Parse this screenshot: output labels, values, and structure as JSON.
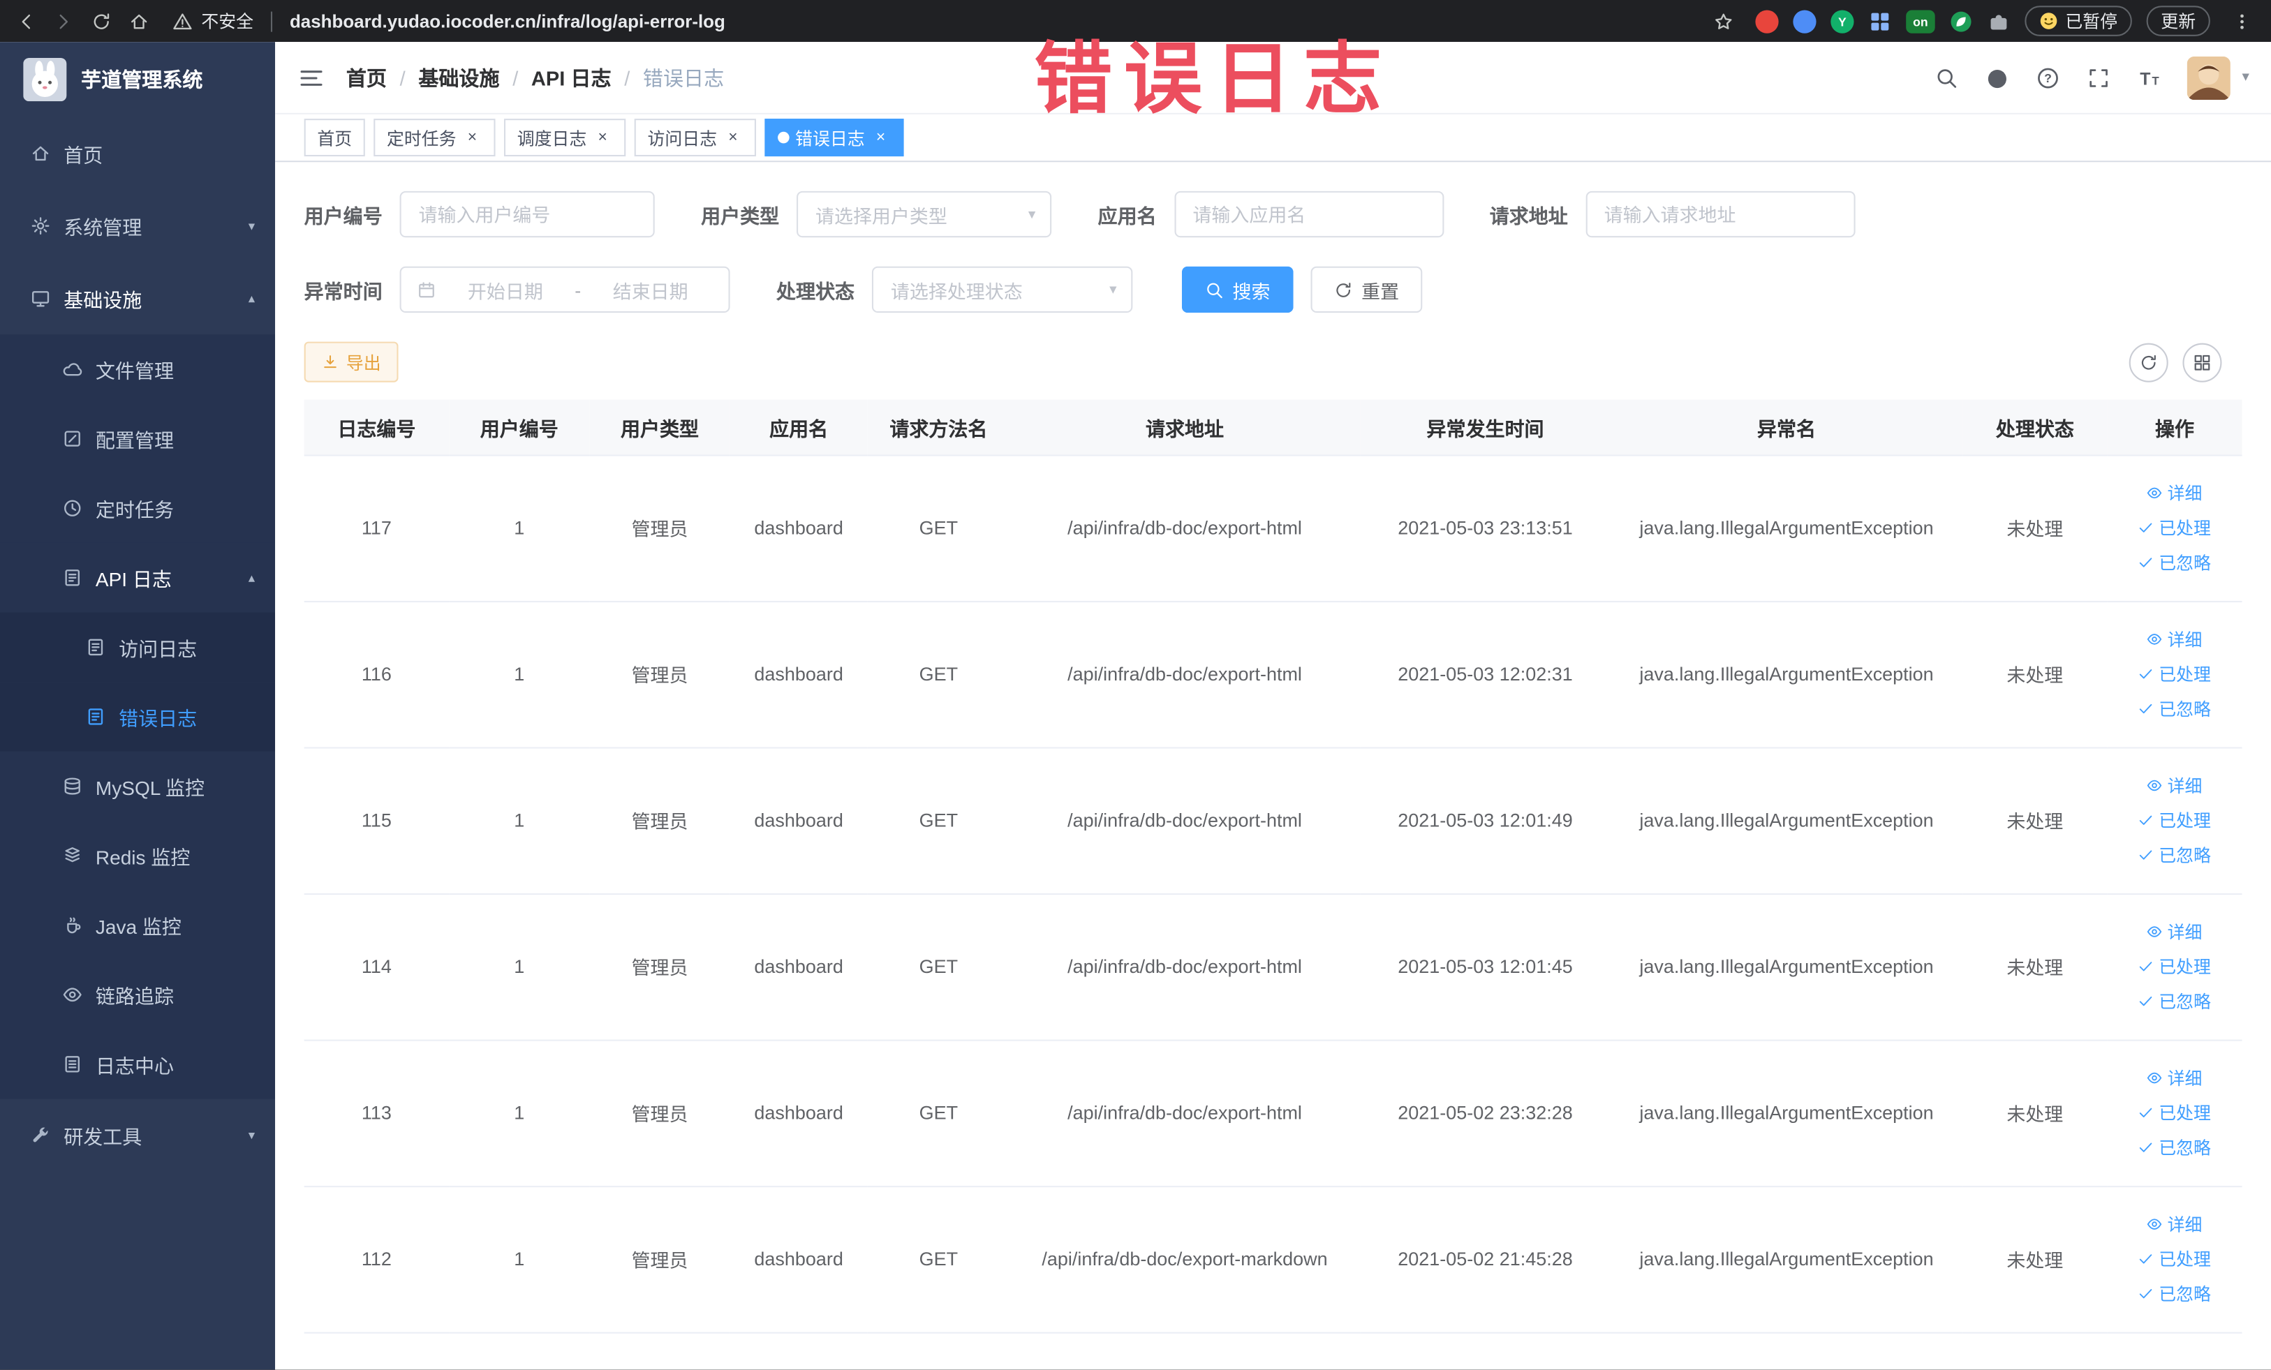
{
  "annotation": {
    "text": "错误日志",
    "color": "#ec4e5e"
  },
  "browser": {
    "security_label": "不安全",
    "url": "dashboard.yudao.iocoder.cn/infra/log/api-error-log",
    "paused_badge": "已暂停",
    "update_label": "更新",
    "extensions": [
      {
        "name": "extension-red-circle-icon",
        "style": "circle",
        "color": "#e8453c",
        "badge": ""
      },
      {
        "name": "extension-blue-drop-icon",
        "style": "circle",
        "color": "#4e8df6",
        "badge": ""
      },
      {
        "name": "extension-green-y-icon",
        "style": "circle",
        "color": "#12b06a",
        "badge": "Y"
      },
      {
        "name": "extension-grid-icon",
        "style": "grid",
        "color": "#8ab4f8",
        "badge": ""
      },
      {
        "name": "extension-on-badge-icon",
        "style": "rounded",
        "color": "#1a7f37",
        "badge": "on"
      },
      {
        "name": "extension-leaf-icon",
        "style": "leaf",
        "color": "#1e9e57",
        "badge": ""
      },
      {
        "name": "extension-puzzle-icon",
        "style": "puzzle",
        "color": "#a8adb3",
        "badge": ""
      }
    ]
  },
  "sidebar": {
    "logo_title": "芋道管理系统",
    "menu": [
      {
        "id": "home",
        "label": "首页",
        "icon": "home-icon",
        "level": 1
      },
      {
        "id": "system",
        "label": "系统管理",
        "icon": "gear-icon",
        "level": 1,
        "arrow": "down"
      },
      {
        "id": "infra",
        "label": "基础设施",
        "icon": "monitor-icon",
        "level": 1,
        "arrow": "up",
        "expanded": true
      },
      {
        "id": "file",
        "label": "文件管理",
        "icon": "cloud-icon",
        "level": 2
      },
      {
        "id": "config",
        "label": "配置管理",
        "icon": "edit-icon",
        "level": 2
      },
      {
        "id": "job",
        "label": "定时任务",
        "icon": "clock-icon",
        "level": 2
      },
      {
        "id": "api-log",
        "label": "API 日志",
        "icon": "doc-edit-icon",
        "level": 2,
        "arrow": "up",
        "expanded": true
      },
      {
        "id": "access-log",
        "label": "访问日志",
        "icon": "doc-edit-icon",
        "level": 3
      },
      {
        "id": "error-log",
        "label": "错误日志",
        "icon": "doc-edit-icon",
        "level": 3,
        "active": true
      },
      {
        "id": "mysql",
        "label": "MySQL 监控",
        "icon": "database-icon",
        "level": 2
      },
      {
        "id": "redis",
        "label": "Redis 监控",
        "icon": "redis-icon",
        "level": 2
      },
      {
        "id": "java",
        "label": "Java 监控",
        "icon": "java-icon",
        "level": 2
      },
      {
        "id": "tracer",
        "label": "链路追踪",
        "icon": "eye-icon",
        "level": 2
      },
      {
        "id": "log-center",
        "label": "日志中心",
        "icon": "log-icon",
        "level": 2
      },
      {
        "id": "dev-tools",
        "label": "研发工具",
        "icon": "tools-icon",
        "level": 1,
        "arrow": "down"
      }
    ]
  },
  "navbar": {
    "breadcrumb": [
      {
        "label": "首页"
      },
      {
        "label": "基础设施"
      },
      {
        "label": "API 日志"
      },
      {
        "label": "错误日志",
        "current": true
      }
    ]
  },
  "tags": [
    {
      "id": "home",
      "label": "首页",
      "closable": false,
      "active": false
    },
    {
      "id": "job",
      "label": "定时任务",
      "closable": true,
      "active": false
    },
    {
      "id": "job-log",
      "label": "调度日志",
      "closable": true,
      "active": false
    },
    {
      "id": "access-log",
      "label": "访问日志",
      "closable": true,
      "active": false
    },
    {
      "id": "error-log",
      "label": "错误日志",
      "closable": true,
      "active": true
    }
  ],
  "filters": {
    "user_id": {
      "label": "用户编号",
      "placeholder": "请输入用户编号"
    },
    "user_type": {
      "label": "用户类型",
      "placeholder": "请选择用户类型"
    },
    "app_name": {
      "label": "应用名",
      "placeholder": "请输入应用名"
    },
    "request_url": {
      "label": "请求地址",
      "placeholder": "请输入请求地址"
    },
    "exception_time": {
      "label": "异常时间",
      "start_placeholder": "开始日期",
      "separator": "-",
      "end_placeholder": "结束日期"
    },
    "process_status": {
      "label": "处理状态",
      "placeholder": "请选择处理状态"
    },
    "search_button": "搜索",
    "reset_button": "重置"
  },
  "toolbar": {
    "export_label": "导出"
  },
  "table": {
    "columns": [
      "日志编号",
      "用户编号",
      "用户类型",
      "应用名",
      "请求方法名",
      "请求地址",
      "异常发生时间",
      "异常名",
      "处理状态",
      "操作"
    ],
    "action_labels": {
      "detail": "详细",
      "processed": "已处理",
      "ignored": "已忽略"
    },
    "rows": [
      {
        "id": "117",
        "user_id": "1",
        "user_type": "管理员",
        "app": "dashboard",
        "method": "GET",
        "url": "/api/infra/db-doc/export-html",
        "time": "2021-05-03 23:13:51",
        "exception": "java.lang.IllegalArgumentException",
        "status": "未处理"
      },
      {
        "id": "116",
        "user_id": "1",
        "user_type": "管理员",
        "app": "dashboard",
        "method": "GET",
        "url": "/api/infra/db-doc/export-html",
        "time": "2021-05-03 12:02:31",
        "exception": "java.lang.IllegalArgumentException",
        "status": "未处理"
      },
      {
        "id": "115",
        "user_id": "1",
        "user_type": "管理员",
        "app": "dashboard",
        "method": "GET",
        "url": "/api/infra/db-doc/export-html",
        "time": "2021-05-03 12:01:49",
        "exception": "java.lang.IllegalArgumentException",
        "status": "未处理"
      },
      {
        "id": "114",
        "user_id": "1",
        "user_type": "管理员",
        "app": "dashboard",
        "method": "GET",
        "url": "/api/infra/db-doc/export-html",
        "time": "2021-05-03 12:01:45",
        "exception": "java.lang.IllegalArgumentException",
        "status": "未处理"
      },
      {
        "id": "113",
        "user_id": "1",
        "user_type": "管理员",
        "app": "dashboard",
        "method": "GET",
        "url": "/api/infra/db-doc/export-html",
        "time": "2021-05-02 23:32:28",
        "exception": "java.lang.IllegalArgumentException",
        "status": "未处理"
      },
      {
        "id": "112",
        "user_id": "1",
        "user_type": "管理员",
        "app": "dashboard",
        "method": "GET",
        "url": "/api/infra/db-doc/export-markdown",
        "time": "2021-05-02 21:45:28",
        "exception": "java.lang.IllegalArgumentException",
        "status": "未处理"
      }
    ]
  }
}
